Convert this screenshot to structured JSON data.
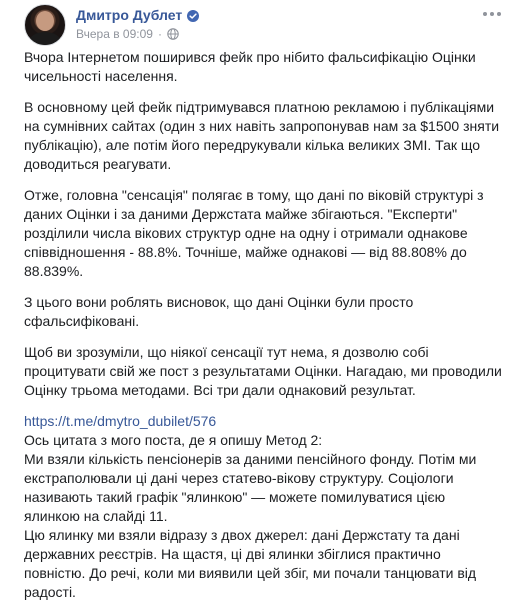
{
  "author": {
    "name": "Дмитро Дублет",
    "verified_icon": "verified-badge-icon",
    "avatar": "profile-photo"
  },
  "meta": {
    "timestamp": "Вчера в 09:09",
    "separator": "·",
    "privacy_icon": "globe-icon"
  },
  "colors": {
    "name": "#385898",
    "link": "#385898",
    "meta": "#90949c",
    "text": "#1c1e21",
    "verified": "#4267b2"
  },
  "post": {
    "p1": "Вчора Інтернетом поширився фейк про нібито фальсифікацію Оцінки чисельності населення.",
    "p2": "В основному цей фейк підтримувався платною рекламою і публікаціями на сумнівних сайтах (один з них навіть запропонував нам за $1500 зняти публікацію), але потім його передрукували кілька великих ЗМІ. Так що доводиться реагувати.",
    "p3": "Отже, головна \"сенсація\" полягає в тому, що дані по віковій структурі з даних Оцінки і за даними Держстата майже збігаються. \"Експерти\" розділили числа вікових структур одне на одну і отримали однакове співвідношення - 88.8%. Точніше, майже однакові — від 88.808% до 88.839%.",
    "p4": "З цього вони роблять висновок, що дані Оцінки були просто сфальсифіковані.",
    "p5": "Щоб ви зрозуміли, що ніякої сенсації тут нема, я дозволю собі процитувати свій же пост з результатами Оцінки. Нагадаю, ми проводили Оцінку трьома методами. Всі три дали однаковий результат.",
    "link": "https://t.me/dmytro_dubilet/576",
    "p6": "Ось цитата з мого поста, де я опишу Метод 2:",
    "p7": "Ми взяли кількість пенсіонерів за даними пенсійного фонду. Потім ми екстраполювали ці дані через статево-вікову структуру. Соціологи називають такий графік \"ялинкою\" — можете помилуватися цією ялинкою на слайді 11.",
    "p8": "Цю ялинку ми взяли відразу з двох джерел: дані Держстату та дані державних реєстрів. На щастя, ці дві ялинки збіглися практично повністю. До речі, коли ми виявили цей збіг, ми почали танцювати від радості."
  }
}
